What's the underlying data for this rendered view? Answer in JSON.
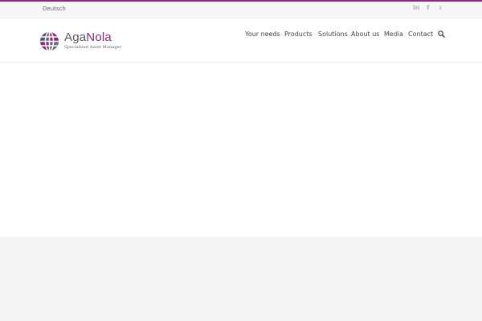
{
  "topbar": {
    "language_link": "Deutsch",
    "social": [
      {
        "icon": "linkedin-icon",
        "glyph": "in"
      },
      {
        "icon": "facebook-icon",
        "glyph": "f"
      },
      {
        "icon": "xing-icon",
        "glyph": "x"
      }
    ]
  },
  "logo": {
    "part1": "Aga",
    "part2": "Nola",
    "tagline": "Specialized Asset Manager"
  },
  "nav": {
    "items": [
      "Your needs",
      "Products",
      "Solutions",
      "About us",
      "Media",
      "Contact"
    ]
  },
  "colors": {
    "accent": "#8b2a7c",
    "logo_grey": "#5a5a66",
    "nav_text": "#444444",
    "social_icon": "#b3b3b3"
  }
}
